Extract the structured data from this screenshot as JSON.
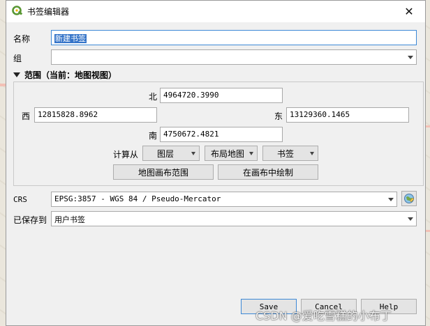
{
  "window": {
    "title": "书签编辑器",
    "close_icon": "✕"
  },
  "name_field": {
    "label": "名称",
    "value": "新建书签"
  },
  "group_field": {
    "label": "组",
    "value": ""
  },
  "extent": {
    "header": "范围（当前：地图视图）",
    "north": {
      "label": "北",
      "value": "4964720.3990"
    },
    "west": {
      "label": "西",
      "value": "12815828.8962"
    },
    "east": {
      "label": "东",
      "value": "13129360.1465"
    },
    "south": {
      "label": "南",
      "value": "4750672.4821"
    },
    "calc_from_label": "计算从",
    "buttons": {
      "layer": "图层",
      "layout_map": "布局地图",
      "bookmark": "书签",
      "canvas_extent": "地图画布范围",
      "draw_on_canvas": "在画布中绘制"
    }
  },
  "crs": {
    "label": "CRS",
    "value": "EPSG:3857 - WGS 84 / Pseudo-Mercator"
  },
  "saved_to": {
    "label": "已保存到",
    "value": "用户书签"
  },
  "footer": {
    "save": "Save",
    "cancel": "Cancel",
    "help": "Help"
  },
  "watermark": "CSDN @爱吃雪糕的小布丁",
  "colors": {
    "accent": "#3574c8",
    "qgis_green": "#589632"
  }
}
